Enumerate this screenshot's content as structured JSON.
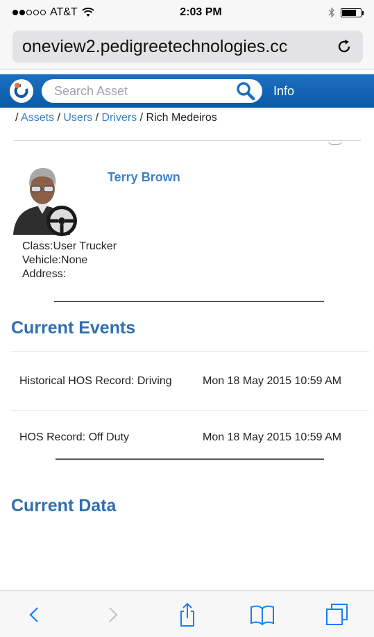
{
  "status_bar": {
    "carrier": "AT&T",
    "time": "2:03 PM",
    "battery_level": 0.8
  },
  "browser": {
    "url": "oneview2.pedigreetechnologies.cc",
    "reload_icon": "reload-icon"
  },
  "app_header": {
    "search_placeholder": "Search Asset",
    "info_tab": "Info"
  },
  "breadcrumb": {
    "items": [
      "Assets",
      "Users",
      "Drivers"
    ],
    "current": "Rich Medeiros"
  },
  "driver": {
    "name": "Terry Brown",
    "class_line": "Class:User Trucker",
    "vehicle_line": "Vehicle:None",
    "address_line": "Address:"
  },
  "current_events": {
    "title": "Current Events",
    "rows": [
      {
        "event": "Historical HOS Record: Driving",
        "time": "Mon 18 May 2015 10:59 AM"
      },
      {
        "event": "HOS Record: Off Duty",
        "time": "Mon 18 May 2015 10:59 AM"
      }
    ]
  },
  "current_data": {
    "title": "Current Data"
  },
  "toolbar": {
    "icons": [
      "back-icon",
      "forward-icon",
      "share-icon",
      "bookmarks-icon",
      "tabs-icon"
    ]
  },
  "colors": {
    "header_blue": "#0a5aa8",
    "link_blue": "#3b7fc4",
    "section_title": "#2f6eb0",
    "ios_blue": "#1a7cf5"
  }
}
